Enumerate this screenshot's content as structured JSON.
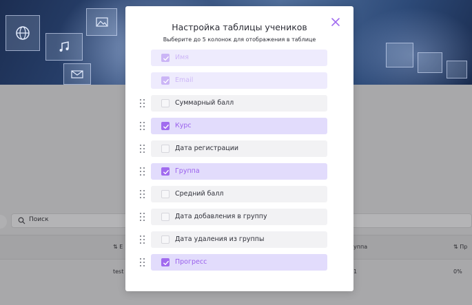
{
  "background": {
    "search_placeholder": "Поиск",
    "table_header_partial": [
      "Е",
      "уппа",
      "Пр"
    ],
    "table_row_partial": [
      "test",
      "1",
      "0%"
    ]
  },
  "modal": {
    "title": "Настройка таблицы учеников",
    "subtitle": "Выберите до 5 колонок для отображения в таблице",
    "close_icon": "close-icon",
    "accent_color": "#a16bef",
    "columns": [
      {
        "label": "Имя",
        "checked": true,
        "locked": true
      },
      {
        "label": "Email",
        "checked": true,
        "locked": true
      },
      {
        "label": "Суммарный балл",
        "checked": false,
        "locked": false
      },
      {
        "label": "Курс",
        "checked": true,
        "locked": false
      },
      {
        "label": "Дата регистрации",
        "checked": false,
        "locked": false
      },
      {
        "label": "Группа",
        "checked": true,
        "locked": false
      },
      {
        "label": "Средний балл",
        "checked": false,
        "locked": false
      },
      {
        "label": "Дата добавления в группу",
        "checked": false,
        "locked": false
      },
      {
        "label": "Дата удаления из группы",
        "checked": false,
        "locked": false
      },
      {
        "label": "Прогресс",
        "checked": true,
        "locked": false
      }
    ]
  }
}
